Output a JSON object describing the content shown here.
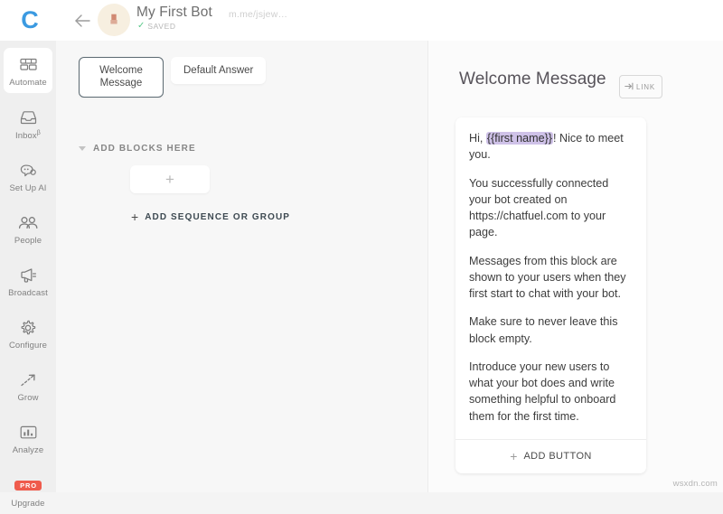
{
  "topbar": {
    "logo_letter": "C",
    "back_icon": "back-arrow-icon",
    "avatar_label": "bot-avatar",
    "bot_title": "My First Bot",
    "saved_check": "✓",
    "saved_label": "SAVED",
    "messenger_url": "m.me/jsjew…"
  },
  "sidebar": {
    "items": [
      {
        "label": "Automate",
        "icon": "blocks-icon",
        "active": true,
        "badge": ""
      },
      {
        "label": "Inbox",
        "icon": "inbox-icon",
        "active": false,
        "badge": "β"
      },
      {
        "label": "Set Up AI",
        "icon": "ai-brain-icon",
        "active": false,
        "badge": ""
      },
      {
        "label": "People",
        "icon": "people-icon",
        "active": false,
        "badge": ""
      },
      {
        "label": "Broadcast",
        "icon": "megaphone-icon",
        "active": false,
        "badge": ""
      },
      {
        "label": "Configure",
        "icon": "gear-icon",
        "active": false,
        "badge": ""
      },
      {
        "label": "Grow",
        "icon": "trend-up-icon",
        "active": false,
        "badge": ""
      },
      {
        "label": "Analyze",
        "icon": "bar-chart-icon",
        "active": false,
        "badge": ""
      },
      {
        "label": "Upgrade",
        "icon": "pro-badge-icon",
        "active": false,
        "badge": "PRO"
      }
    ]
  },
  "canvas": {
    "tabs": [
      {
        "line1": "Welcome",
        "line2": "Message",
        "selected": true
      },
      {
        "line1": "Default Answer",
        "line2": "",
        "selected": false
      }
    ],
    "section_title": "ADD BLOCKS HERE",
    "add_block_plus": "+",
    "add_sequence_plus": "+",
    "add_sequence_label": "ADD SEQUENCE OR GROUP"
  },
  "panel": {
    "title": "Welcome Message",
    "link_badge_label": "LINK",
    "message": {
      "p1_pre": "Hi, ",
      "p1_token": "{{first name}}",
      "p1_post": "! Nice to meet you.",
      "p2": "You successfully connected your bot created on https://chatfuel.com to your page.",
      "p3": "Messages from this block are shown to your users when they first start to chat with your bot.",
      "p4": "Make sure to never leave this block empty.",
      "p5": "Introduce your new users to what your bot does and write something helpful to onboard them for the first time."
    },
    "add_button_plus": "+",
    "add_button_label": "ADD BUTTON"
  },
  "watermark": "wsxdn.com",
  "colors": {
    "brand_blue": "#3b9ae1",
    "saved_green": "#5cc98b",
    "pro_red": "#ef5b4c",
    "token_purple": "#cfc2e8",
    "sidebar_bg": "#efefef",
    "canvas_bg": "#f7f7f7"
  }
}
